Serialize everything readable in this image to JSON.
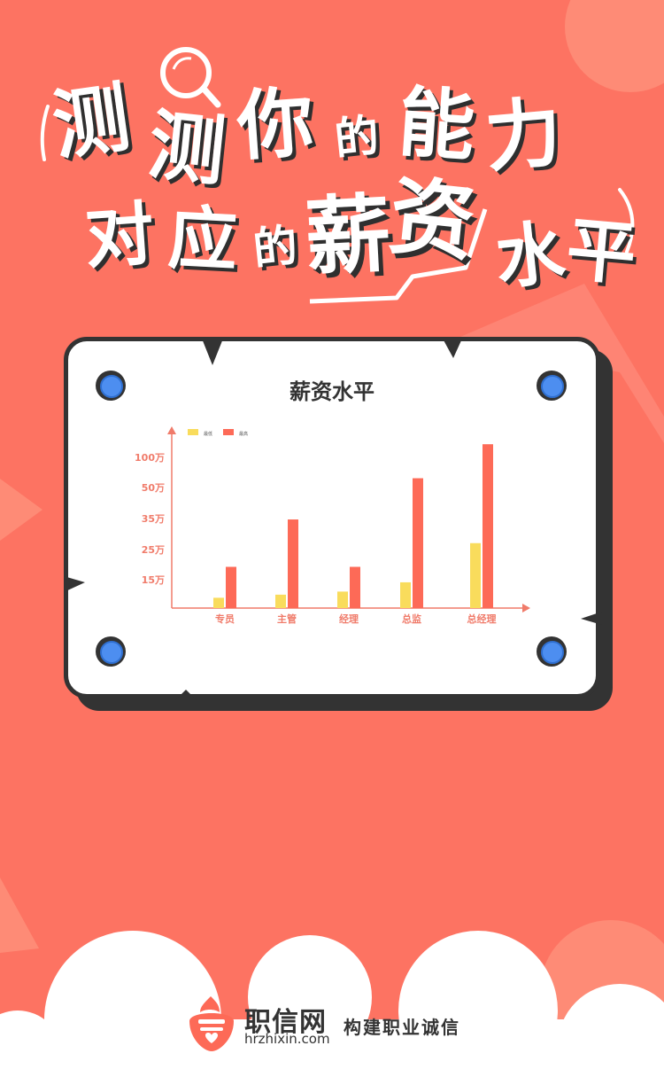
{
  "headline": {
    "line1": [
      "测",
      "测",
      "你",
      "的",
      "能",
      "力"
    ],
    "line2": [
      "对",
      "应",
      "的",
      "薪",
      "资",
      "水",
      "平"
    ]
  },
  "chart_data": {
    "type": "bar",
    "title": "薪资水平",
    "categories": [
      "专员",
      "主管",
      "经理",
      "总监",
      "总经理"
    ],
    "y_tick_labels": [
      "15万",
      "25万",
      "35万",
      "50万",
      "100万"
    ],
    "series": [
      {
        "name": "最低",
        "color": "#f9dc5c",
        "values": [
          1,
          1.3,
          1.6,
          2.5,
          6.3
        ]
      },
      {
        "name": "最高",
        "color": "#fd6a57",
        "values": [
          4,
          8.6,
          4,
          12.6,
          15.9
        ]
      }
    ],
    "legend_position": "top-left",
    "grid": false,
    "axis_color": "#f07b6a"
  },
  "footer": {
    "brand": "职信网",
    "url": "hrzhixin.com",
    "slogan": "构建职业诚信"
  }
}
